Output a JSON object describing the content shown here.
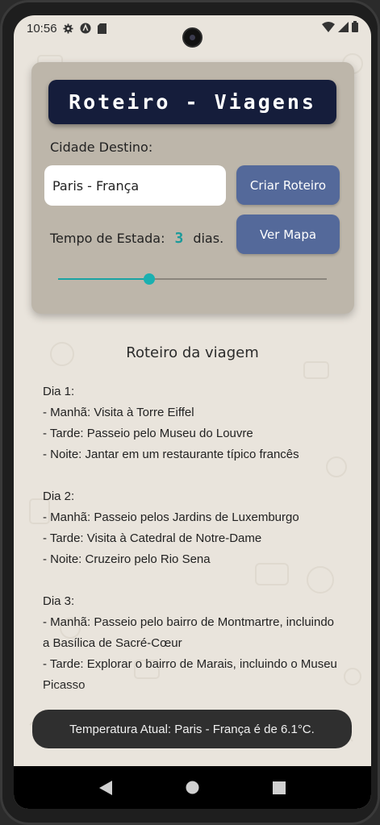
{
  "status_bar": {
    "time": "10:56",
    "icons": [
      "gear-icon",
      "a-circle-icon",
      "sd-card-icon"
    ],
    "right_icons": [
      "wifi-icon",
      "signal-icon",
      "battery-icon"
    ]
  },
  "card": {
    "title": "Roteiro - Viagens",
    "city_label": "Cidade Destino:",
    "city_value": "Paris - França",
    "create_button": "Criar Roteiro",
    "map_button": "Ver Mapa",
    "stay_label": "Tempo de Estada:",
    "stay_days": "3",
    "stay_unit": "dias.",
    "slider_fraction": 0.34
  },
  "itinerary": {
    "title": "Roteiro da viagem",
    "days": [
      {
        "heading": "Dia 1:",
        "items": [
          "- Manhã: Visita à Torre Eiffel",
          "- Tarde: Passeio pelo Museu do Louvre",
          "- Noite: Jantar em um restaurante típico francês"
        ]
      },
      {
        "heading": "Dia 2:",
        "items": [
          "- Manhã: Passeio pelos Jardins de Luxemburgo",
          "- Tarde: Visita à Catedral de Notre-Dame",
          "- Noite: Cruzeiro pelo Rio Sena"
        ]
      },
      {
        "heading": "Dia 3:",
        "items": [
          "- Manhã: Passeio pelo bairro de Montmartre, incluindo a Basílica de Sacré-Cœur",
          "- Tarde: Explorar o bairro de Marais, incluindo o Museu Picasso"
        ]
      }
    ]
  },
  "toast": {
    "text": "Temperatura Atual: Paris - França é de 6.1°C."
  },
  "nav": {
    "icons": [
      "back-icon",
      "home-icon",
      "recents-icon"
    ]
  },
  "colors": {
    "banner": "#151d3b",
    "button": "#54699a",
    "accent": "#1aa3a3",
    "card": "#bdb6aa",
    "background": "#e9e4dc"
  }
}
